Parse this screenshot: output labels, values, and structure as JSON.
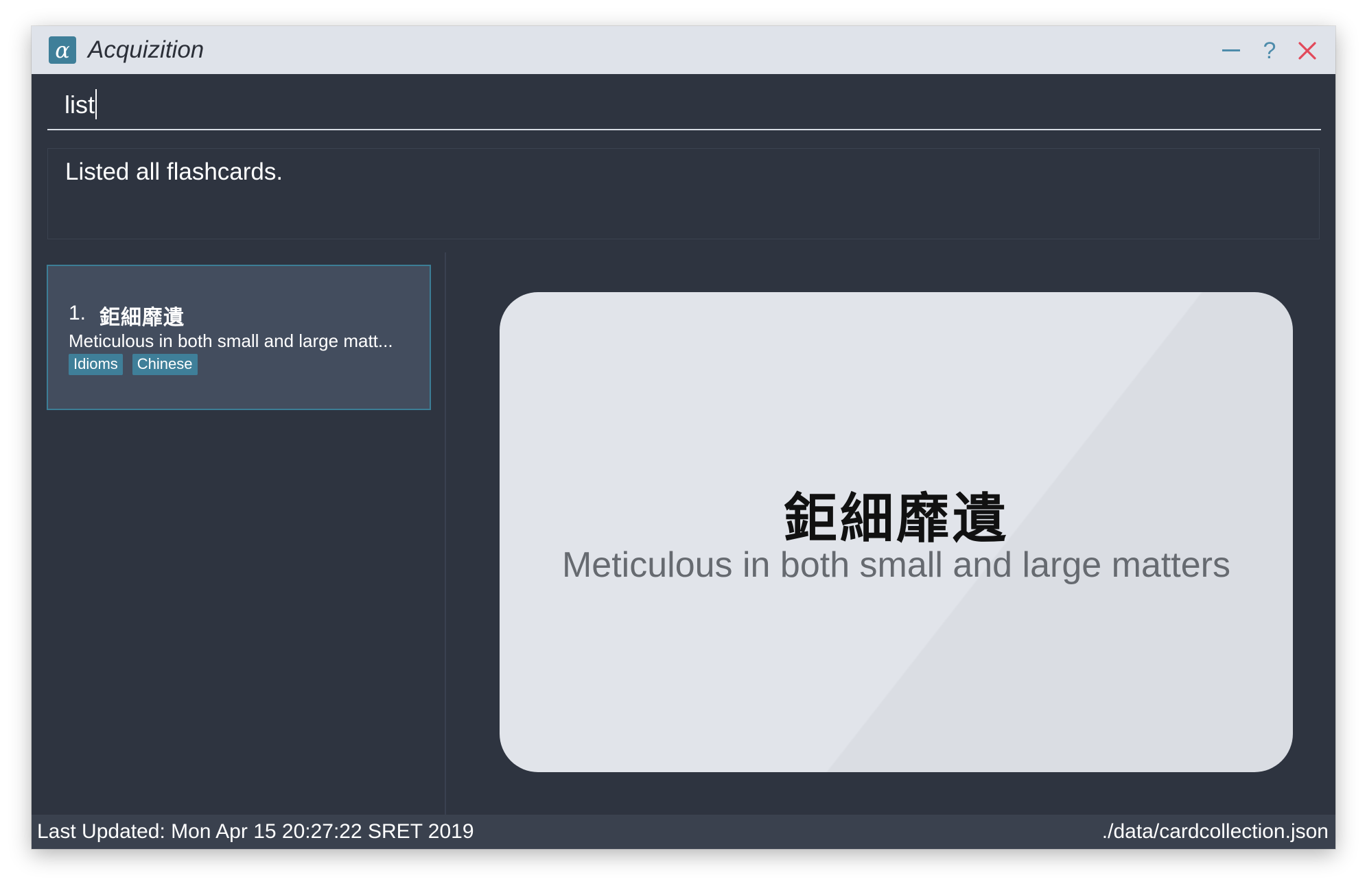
{
  "window": {
    "title": "Acquizition",
    "logo_glyph": "α",
    "help_glyph": "?",
    "accent_color": "#3f7f99",
    "close_color": "#e2495a"
  },
  "command": {
    "value": "list"
  },
  "result": {
    "message": "Listed all flashcards."
  },
  "card_list": {
    "items": [
      {
        "index": "1.",
        "question": "鉅細靡遺",
        "answer": "Meticulous in both small and large matt...",
        "tags": [
          "Idioms",
          "Chinese"
        ]
      }
    ]
  },
  "flashcard": {
    "question": "鉅細靡遺",
    "answer": "Meticulous in both small and large matters"
  },
  "status": {
    "last_updated": "Last Updated: Mon Apr 15 20:27:22 SRET 2019",
    "file_path": "./data/cardcollection.json"
  }
}
